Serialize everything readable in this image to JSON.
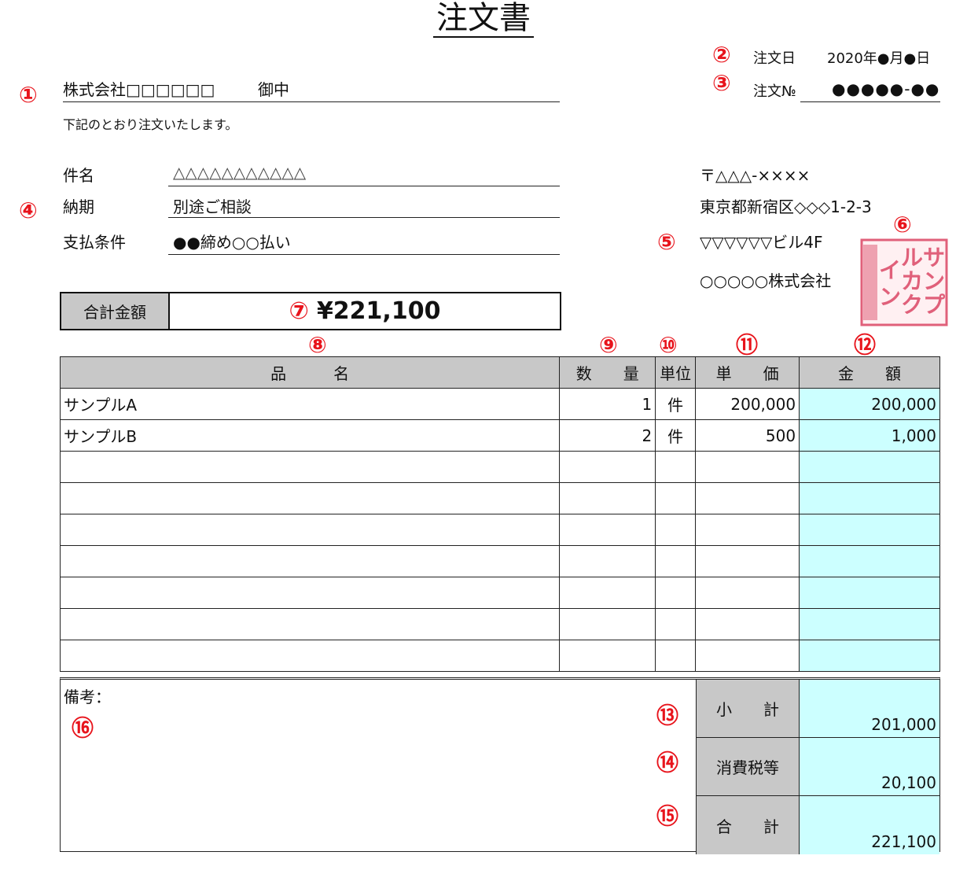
{
  "title": "注文書",
  "markers": [
    "①",
    "②",
    "③",
    "④",
    "⑤",
    "⑥",
    "⑦",
    "⑧",
    "⑨",
    "⑩",
    "⑪",
    "⑫",
    "⑬",
    "⑭",
    "⑮",
    "⑯"
  ],
  "order_date": {
    "label": "注文日",
    "value": "2020年●月●日"
  },
  "order_no": {
    "label": "注文№",
    "value": "●●●●●-●●"
  },
  "recipient": {
    "name": "株式会社□□□□□□",
    "honorific": "御中"
  },
  "intro": "下記のとおり注文いたします。",
  "details": [
    {
      "label": "件名",
      "value": "△△△△△△△△△△△"
    },
    {
      "label": "納期",
      "value": "別途ご相談"
    },
    {
      "label": "支払条件",
      "value": "●●締め○○払い"
    }
  ],
  "issuer": {
    "postal": "〒△△△-××××",
    "address": "東京都新宿区◇◇◇1-2-3",
    "building": "▽▽▽▽▽▽ビル4F",
    "company": "○○○○○株式会社"
  },
  "stamp_text": "サンプルカクイン",
  "total": {
    "label": "合計金額",
    "value": "¥221,100"
  },
  "table": {
    "headers": {
      "name": "品　　　名",
      "qty": "数　　量",
      "unit": "単位",
      "price": "単　　価",
      "amount": "金　　額"
    },
    "rows": [
      {
        "name": "サンプルA",
        "qty": "1",
        "unit": "件",
        "price": "200,000",
        "amount": "200,000"
      },
      {
        "name": "サンプルB",
        "qty": "2",
        "unit": "件",
        "price": "500",
        "amount": "1,000"
      },
      {
        "name": "",
        "qty": "",
        "unit": "",
        "price": "",
        "amount": ""
      },
      {
        "name": "",
        "qty": "",
        "unit": "",
        "price": "",
        "amount": ""
      },
      {
        "name": "",
        "qty": "",
        "unit": "",
        "price": "",
        "amount": ""
      },
      {
        "name": "",
        "qty": "",
        "unit": "",
        "price": "",
        "amount": ""
      },
      {
        "name": "",
        "qty": "",
        "unit": "",
        "price": "",
        "amount": ""
      },
      {
        "name": "",
        "qty": "",
        "unit": "",
        "price": "",
        "amount": ""
      },
      {
        "name": "",
        "qty": "",
        "unit": "",
        "price": "",
        "amount": ""
      }
    ]
  },
  "remarks_label": "備考：",
  "summary": {
    "subtotal": {
      "label": "小　　計",
      "value": "201,000"
    },
    "tax": {
      "label": "消費税等",
      "value": "20,100"
    },
    "total": {
      "label": "合　　計",
      "value": "221,100"
    }
  }
}
